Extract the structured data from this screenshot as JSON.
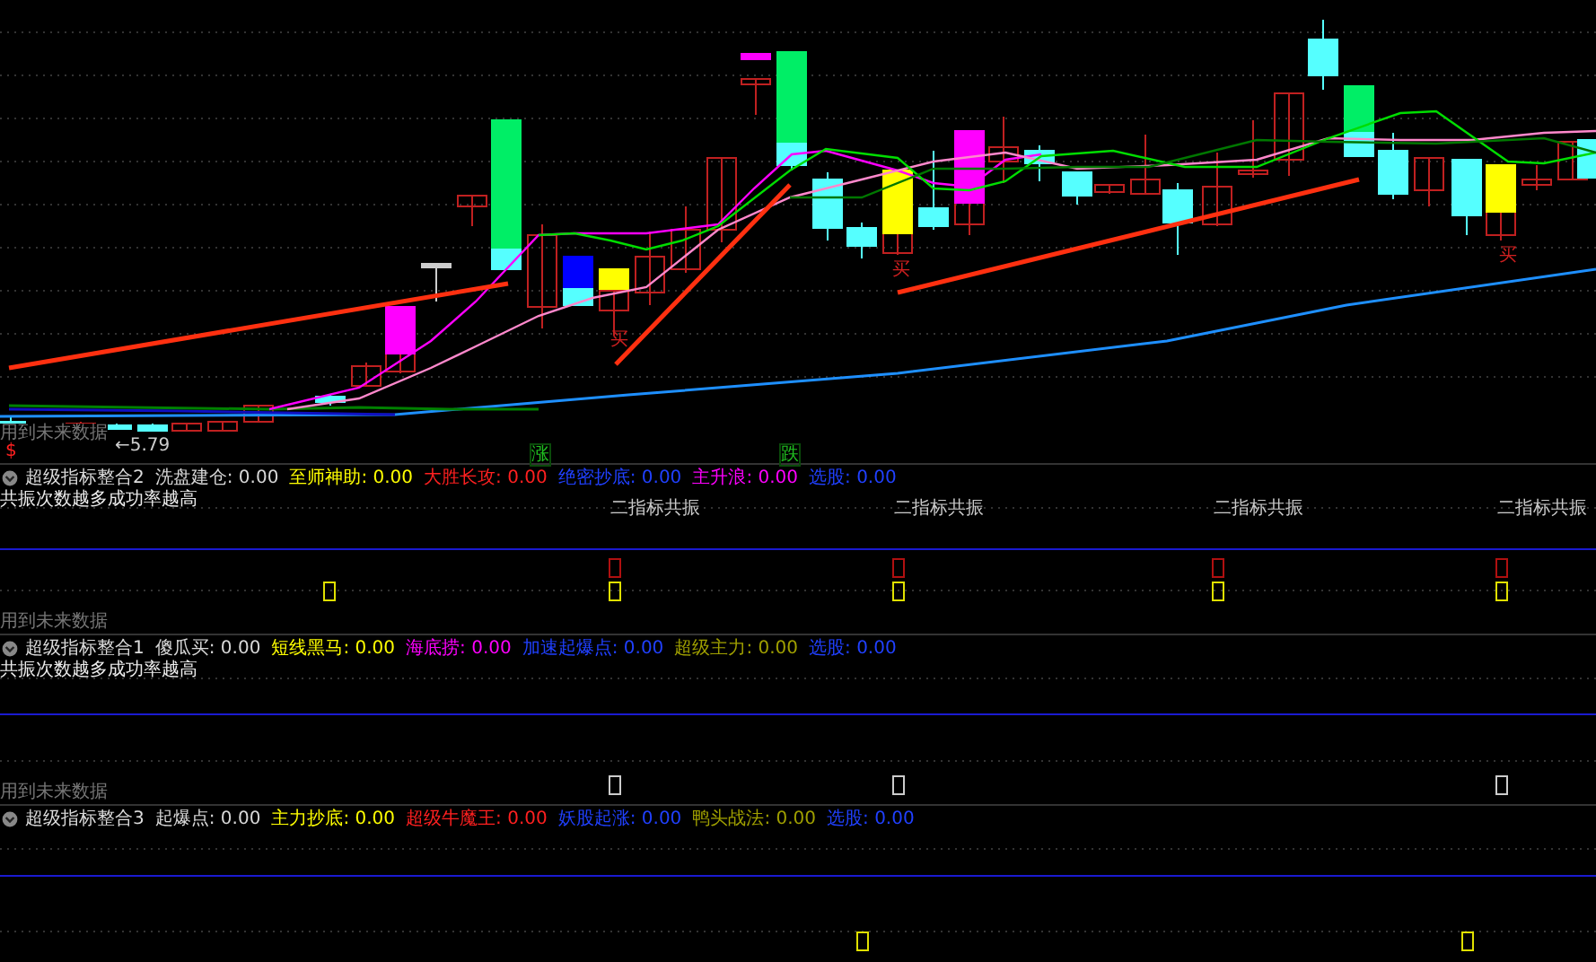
{
  "chart": {
    "footnote": "用到未来数据",
    "price_label": "←5.79",
    "markers": [
      {
        "text": "$",
        "color": "#ff2020"
      },
      {
        "text": "涨",
        "color": "#20c020"
      },
      {
        "text": "跌",
        "color": "#20c020"
      },
      {
        "text": "买",
        "color": "#d02020"
      },
      {
        "text": "买",
        "color": "#d02020"
      },
      {
        "text": "买",
        "color": "#d02020"
      }
    ]
  },
  "panels": [
    {
      "title": "超级指标整合2",
      "indicators": [
        {
          "text": "洗盘建仓: 0.00",
          "color": "#d8d8d8"
        },
        {
          "text": "至师神助: 0.00",
          "color": "#ffff00"
        },
        {
          "text": "大胜长攻: 0.00",
          "color": "#ff2020"
        },
        {
          "text": "绝密抄底: 0.00",
          "color": "#2040ff"
        },
        {
          "text": "主升浪: 0.00",
          "color": "#ff00ff"
        },
        {
          "text": "选股: 0.00",
          "color": "#2040ff"
        }
      ],
      "note": "共振次数越多成功率越高",
      "signals": [
        "二指标共振",
        "二指标共振",
        "二指标共振",
        "二指标共振"
      ],
      "footnote": "用到未来数据"
    },
    {
      "title": "超级指标整合1",
      "indicators": [
        {
          "text": "傻瓜买: 0.00",
          "color": "#d8d8d8"
        },
        {
          "text": "短线黑马: 0.00",
          "color": "#ffff00"
        },
        {
          "text": "海底捞: 0.00",
          "color": "#ff00ff"
        },
        {
          "text": "加速起爆点: 0.00",
          "color": "#2040ff"
        },
        {
          "text": "超级主力: 0.00",
          "color": "#a0a000"
        },
        {
          "text": "选股: 0.00",
          "color": "#2040ff"
        }
      ],
      "note": "共振次数越多成功率越高",
      "footnote": "用到未来数据"
    },
    {
      "title": "超级指标整合3",
      "indicators": [
        {
          "text": "起爆点: 0.00",
          "color": "#d8d8d8"
        },
        {
          "text": "主力抄底: 0.00",
          "color": "#ffff00"
        },
        {
          "text": "超级牛魔王: 0.00",
          "color": "#ff2020"
        },
        {
          "text": "妖股起涨: 0.00",
          "color": "#2040ff"
        },
        {
          "text": "鸭头战法: 0.00",
          "color": "#a0a000"
        },
        {
          "text": "选股: 0.00",
          "color": "#2040ff"
        }
      ]
    }
  ]
}
